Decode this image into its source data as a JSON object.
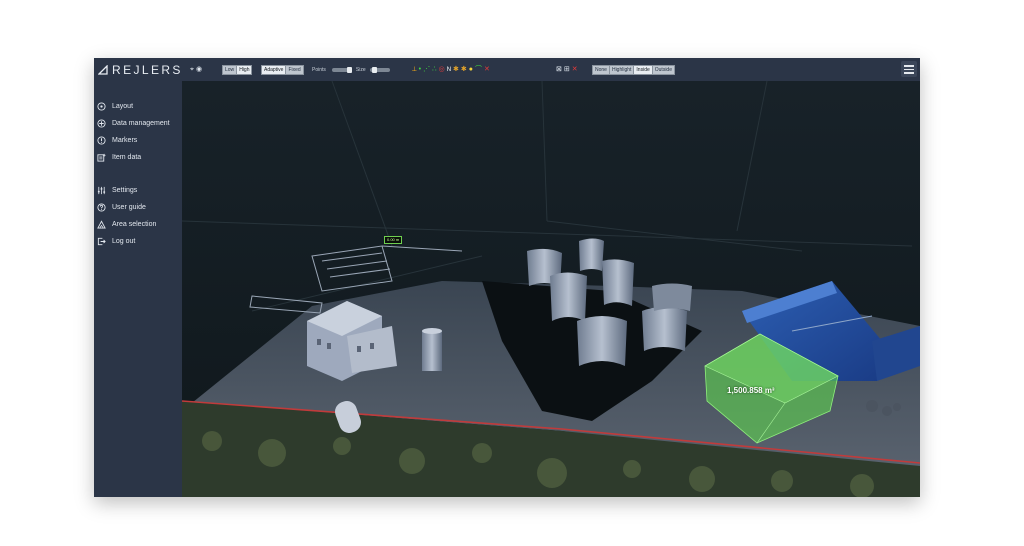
{
  "app": {
    "brand": "REJLERS"
  },
  "toolbar": {
    "quality": [
      "Low",
      "High"
    ],
    "mode": [
      "Adaptive",
      "Fixed"
    ],
    "points_label": "Points",
    "size_label": "Size",
    "clip": [
      "None",
      "Highlight",
      "Inside",
      "Outside"
    ]
  },
  "sidebar": {
    "items": [
      {
        "label": "Layout",
        "icon": "layout-icon"
      },
      {
        "label": "Data management",
        "icon": "plus-circle-icon"
      },
      {
        "label": "Markers",
        "icon": "marker-icon"
      },
      {
        "label": "Item data",
        "icon": "item-data-icon"
      },
      {
        "label": "Settings",
        "icon": "sliders-icon"
      },
      {
        "label": "User guide",
        "icon": "help-icon"
      },
      {
        "label": "Area selection",
        "icon": "area-selection-icon"
      },
      {
        "label": "Log out",
        "icon": "logout-icon"
      }
    ]
  },
  "viewer": {
    "distance_label": "0.00 m",
    "volume_label": "1,500.858 m³"
  },
  "colors": {
    "chrome": "#2b3547",
    "background": "#ffffff",
    "volume_box": "#5fd64f",
    "measure": "#6fcf4f"
  }
}
